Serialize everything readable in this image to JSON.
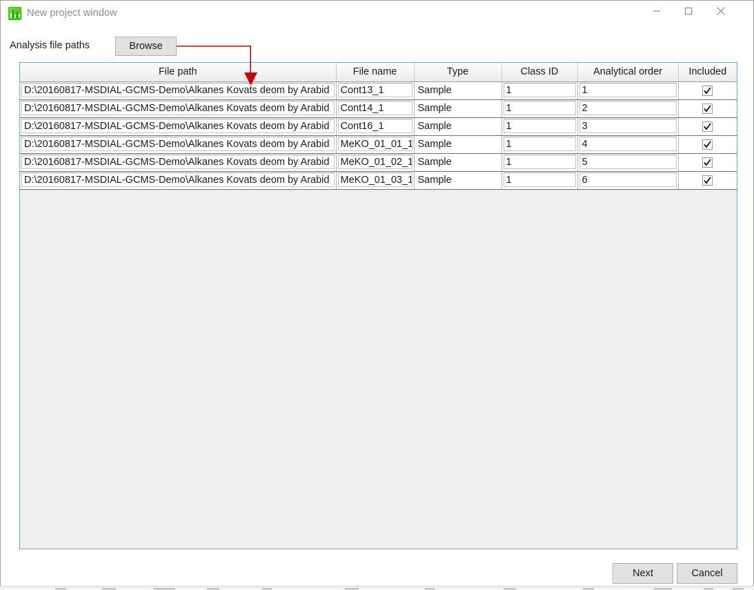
{
  "window": {
    "title": "New project window",
    "icon": "msdial-app-icon",
    "controls": {
      "minimize": "minimize-icon",
      "maximize": "maximize-icon",
      "close": "close-icon"
    }
  },
  "toolbar": {
    "analysis_label": "Analysis file paths",
    "browse_label": "Browse"
  },
  "annotation": {
    "type": "red-arrow",
    "color": "#cc0000",
    "points_from": "Browse",
    "points_to": "File path column"
  },
  "grid": {
    "columns": [
      {
        "key": "file_path",
        "label": "File path"
      },
      {
        "key": "file_name",
        "label": "File name"
      },
      {
        "key": "type",
        "label": "Type"
      },
      {
        "key": "class_id",
        "label": "Class ID"
      },
      {
        "key": "analytical_order",
        "label": "Analytical order"
      },
      {
        "key": "included",
        "label": "Included"
      }
    ],
    "rows": [
      {
        "file_path": "D:\\20160817-MSDIAL-GCMS-Demo\\Alkanes Kovats deom by Arabid",
        "file_name": "Cont13_1",
        "type": "Sample",
        "class_id": "1",
        "analytical_order": "1",
        "included": true
      },
      {
        "file_path": "D:\\20160817-MSDIAL-GCMS-Demo\\Alkanes Kovats deom by Arabid",
        "file_name": "Cont14_1",
        "type": "Sample",
        "class_id": "1",
        "analytical_order": "2",
        "included": true
      },
      {
        "file_path": "D:\\20160817-MSDIAL-GCMS-Demo\\Alkanes Kovats deom by Arabid",
        "file_name": "Cont16_1",
        "type": "Sample",
        "class_id": "1",
        "analytical_order": "3",
        "included": true
      },
      {
        "file_path": "D:\\20160817-MSDIAL-GCMS-Demo\\Alkanes Kovats deom by Arabid",
        "file_name": "MeKO_01_01_1",
        "type": "Sample",
        "class_id": "1",
        "analytical_order": "4",
        "included": true
      },
      {
        "file_path": "D:\\20160817-MSDIAL-GCMS-Demo\\Alkanes Kovats deom by Arabid",
        "file_name": "MeKO_01_02_1",
        "type": "Sample",
        "class_id": "1",
        "analytical_order": "5",
        "included": true
      },
      {
        "file_path": "D:\\20160817-MSDIAL-GCMS-Demo\\Alkanes Kovats deom by Arabid",
        "file_name": "MeKO_01_03_1",
        "type": "Sample",
        "class_id": "1",
        "analytical_order": "6",
        "included": true
      }
    ]
  },
  "footer": {
    "next_label": "Next",
    "cancel_label": "Cancel"
  },
  "colors": {
    "panel_border": "#7da2ce",
    "panel_bg": "#efefef",
    "button_bg": "#e1e1e1",
    "button_border": "#adadad",
    "annotation": "#cc0000",
    "app_icon_green": "#55cf0b"
  }
}
